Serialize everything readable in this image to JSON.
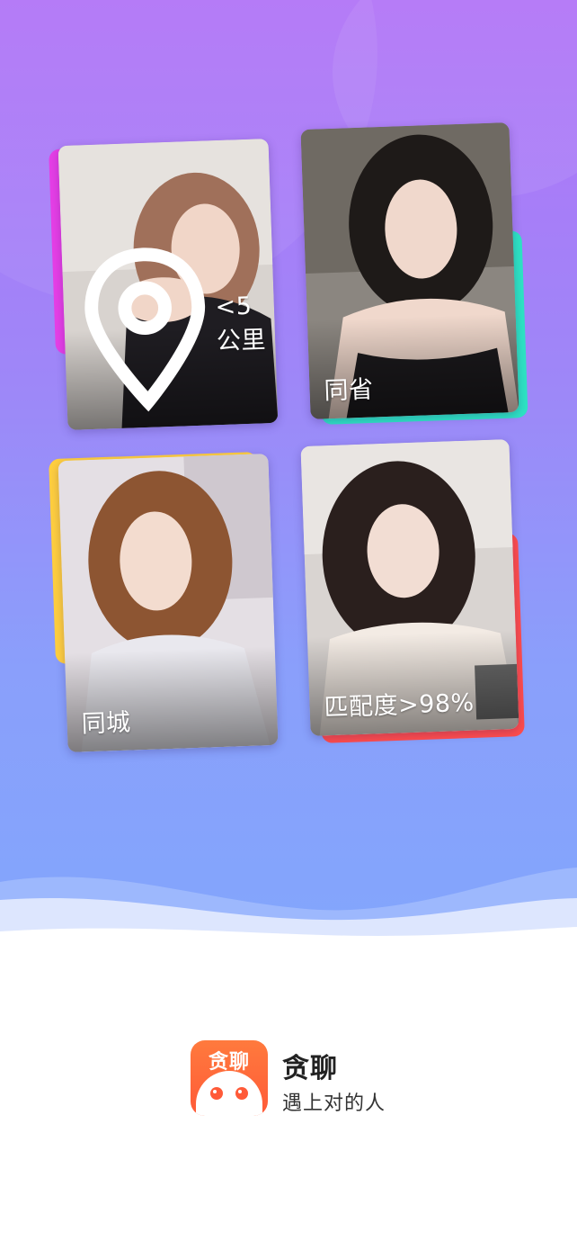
{
  "cards": [
    {
      "label": "<5公里",
      "icon": "location-pin-icon",
      "accent": "#e53fe6"
    },
    {
      "label": "同省",
      "icon": "",
      "accent": "#2ee3c4"
    },
    {
      "label": "同城",
      "icon": "",
      "accent": "#ffcf3f"
    },
    {
      "label": "匹配度>98%",
      "icon": "",
      "accent": "#ff4d4d"
    }
  ],
  "brand": {
    "icon_text": "贪聊",
    "name": "贪聊",
    "slogan": "遇上对的人",
    "icon_color": "#ff5a38"
  },
  "colors": {
    "gradient_top": "#b173f7",
    "gradient_bottom": "#82a6fc"
  }
}
